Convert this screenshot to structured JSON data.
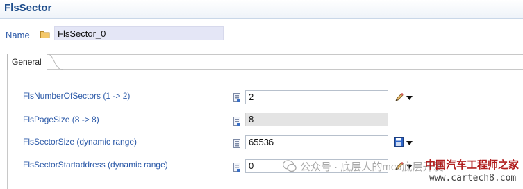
{
  "header": {
    "title": "FlsSector"
  },
  "name_row": {
    "label": "Name",
    "value": "FlsSector_0"
  },
  "tabs": [
    {
      "label": "General"
    }
  ],
  "params": [
    {
      "label": "FlsNumberOfSectors (1 -> 2)",
      "value": "2",
      "editable": true,
      "action_icon": "pencil-icon"
    },
    {
      "label": "FlsPageSize (8 -> 8)",
      "value": "8",
      "editable": false,
      "action_icon": ""
    },
    {
      "label": "FlsSectorSize (dynamic range)",
      "value": "65536",
      "editable": true,
      "action_icon": "save-disk-icon"
    },
    {
      "label": "FlsSectorStartaddress (dynamic range)",
      "value": "0",
      "editable": true,
      "action_icon": "pencil-icon"
    }
  ],
  "watermark": {
    "wechat_text": "公众号 · 底层人的mcu底层开发",
    "site_cn": "中国汽车工程师之家",
    "site_url": "www.cartech8.com"
  },
  "colors": {
    "title": "#1f4e8c",
    "label": "#2b59a8",
    "name_field_bg": "#e4e6f6",
    "readonly_bg": "#e4e4e4"
  }
}
